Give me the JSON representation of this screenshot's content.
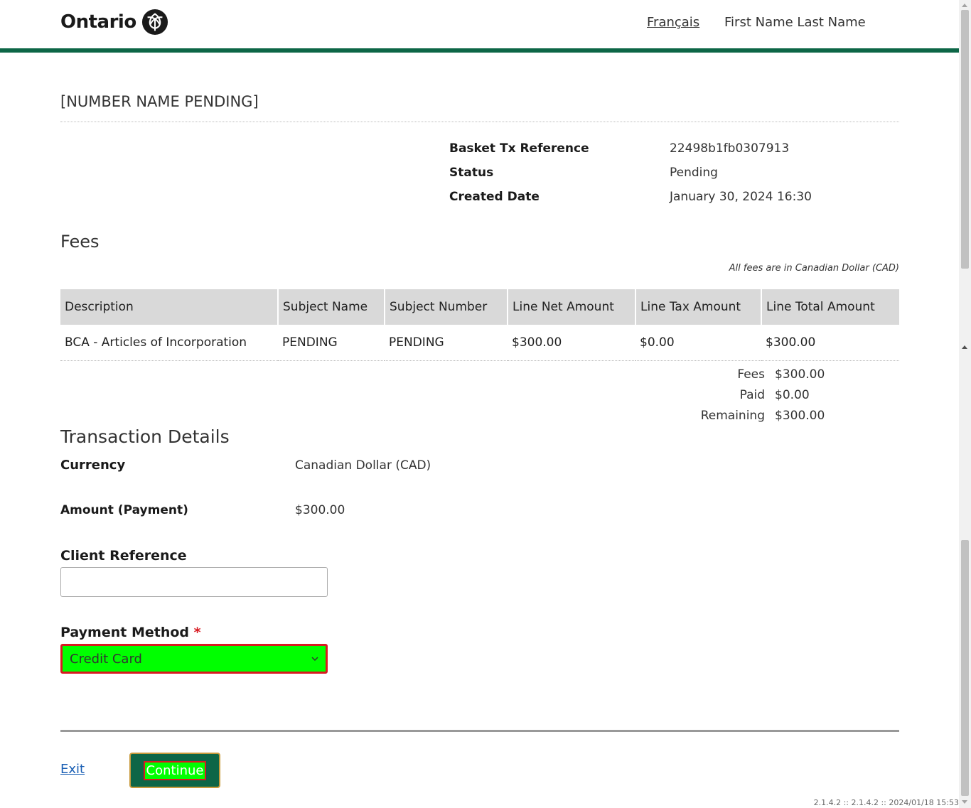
{
  "header": {
    "logo_text": "Ontario",
    "language_link": "Français",
    "user_name": "First Name Last Name"
  },
  "page_title": "[NUMBER NAME PENDING]",
  "meta": [
    {
      "label": "Basket Tx Reference",
      "value": "22498b1fb0307913"
    },
    {
      "label": "Status",
      "value": "Pending"
    },
    {
      "label": "Created Date",
      "value": "January 30, 2024 16:30"
    }
  ],
  "fees": {
    "title": "Fees",
    "note": "All fees are in Canadian Dollar (CAD)",
    "columns": [
      "Description",
      "Subject Name",
      "Subject Number",
      "Line Net Amount",
      "Line Tax Amount",
      "Line Total Amount"
    ],
    "rows": [
      [
        "BCA - Articles of Incorporation",
        "PENDING",
        "PENDING",
        "$300.00",
        "$0.00",
        "$300.00"
      ]
    ],
    "summary": [
      {
        "label": "Fees",
        "value": "$300.00"
      },
      {
        "label": "Paid",
        "value": "$0.00"
      },
      {
        "label": "Remaining",
        "value": "$300.00"
      }
    ]
  },
  "transaction": {
    "title": "Transaction Details",
    "currency_label": "Currency",
    "currency_value": "Canadian Dollar (CAD)",
    "amount_label": "Amount (Payment)",
    "amount_value": "$300.00",
    "client_ref_label": "Client Reference",
    "client_ref_value": "",
    "payment_method_label": "Payment Method",
    "payment_method_required": "*",
    "payment_method_value": "Credit Card"
  },
  "actions": {
    "exit_label": "Exit",
    "continue_label": "Continue"
  },
  "version": "2.1.4.2 :: 2.1.4.2 :: 2024/01/18 15:53",
  "colors": {
    "brand_green": "#0d6647",
    "highlight_green": "#00ff00",
    "error_red": "#d81a21"
  }
}
